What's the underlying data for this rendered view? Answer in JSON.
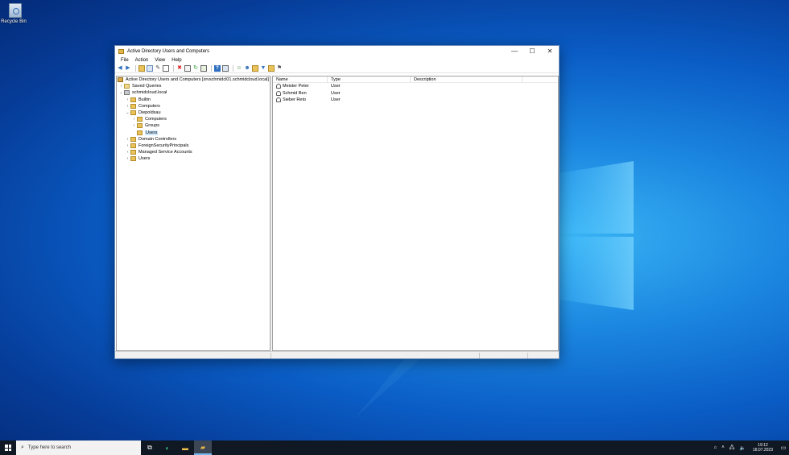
{
  "desktop": {
    "icons": [
      {
        "label": "Recycle Bin",
        "icon": "recycle-bin-icon"
      }
    ]
  },
  "window": {
    "title": "Active Directory Users and Computers",
    "controls": {
      "minimize": "—",
      "maximize": "☐",
      "close": "✕"
    },
    "menu": [
      "File",
      "Action",
      "Help"
    ],
    "menu_full": [
      "File",
      "Action",
      "View",
      "Help"
    ],
    "toolbar_icons": [
      "back-icon",
      "forward-icon",
      "up-folder-icon",
      "console-tree-icon",
      "properties-icon",
      "copy-icon",
      "delete-icon",
      "export-icon",
      "refresh-icon",
      "export-list-icon",
      "help-icon",
      "console-icon",
      "add-user-icon",
      "add-group-icon",
      "add-ou-icon",
      "filter-icon",
      "find-icon",
      "add-to-group-icon"
    ]
  },
  "tree": {
    "root": "Active Directory Users and Computers [srvschmidcl01.schmidcloud.local]",
    "saved_queries": "Saved Queries",
    "domain": "schmidcloud.local",
    "builtin": "Builtin",
    "computers": "Computers",
    "diepoldsau": "Diepoldsau",
    "diep_computers": "Computers",
    "diep_groups": "Groups",
    "diep_users": "Users",
    "domain_controllers": "Domain Controllers",
    "fsp": "ForeignSecurityPrincipals",
    "msa": "Managed Service Accounts",
    "users": "Users"
  },
  "list": {
    "columns": {
      "name": "Name",
      "type": "Type",
      "description": "Description"
    },
    "rows": [
      {
        "name": "Meister Peter",
        "type": "User",
        "description": ""
      },
      {
        "name": "Schmid Ben",
        "type": "User",
        "description": ""
      },
      {
        "name": "Sieber Reto",
        "type": "User",
        "description": ""
      }
    ]
  },
  "taskbar": {
    "search_placeholder": "Type here to search",
    "pinned": [
      "task-view-icon",
      "edge-icon",
      "file-explorer-icon",
      "aduc-icon"
    ],
    "time": "19:12",
    "date": "18.07.2023"
  },
  "colors": {
    "accent": "#0a5cc5",
    "selection": "#cce8ff",
    "folder": "#e9c25a"
  }
}
